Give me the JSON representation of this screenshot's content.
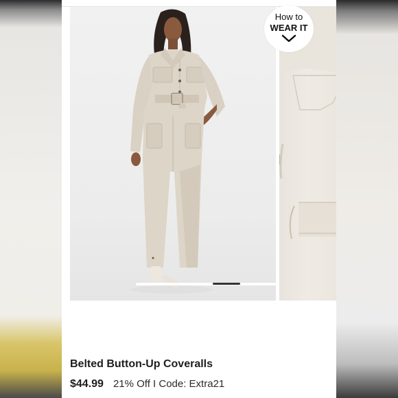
{
  "listing": {
    "badge_line1": "How to",
    "badge_line2": "WEAR IT",
    "title": "Belted Button-Up Coveralls",
    "price": "$44.99",
    "promo": "21% Off I Code: Extra21"
  },
  "gallery": {
    "active_index": 2,
    "photo_colors": {
      "garment": "#ddd5c7",
      "garment_shadow": "#c9c0b1",
      "background": "#eeeeee"
    }
  }
}
